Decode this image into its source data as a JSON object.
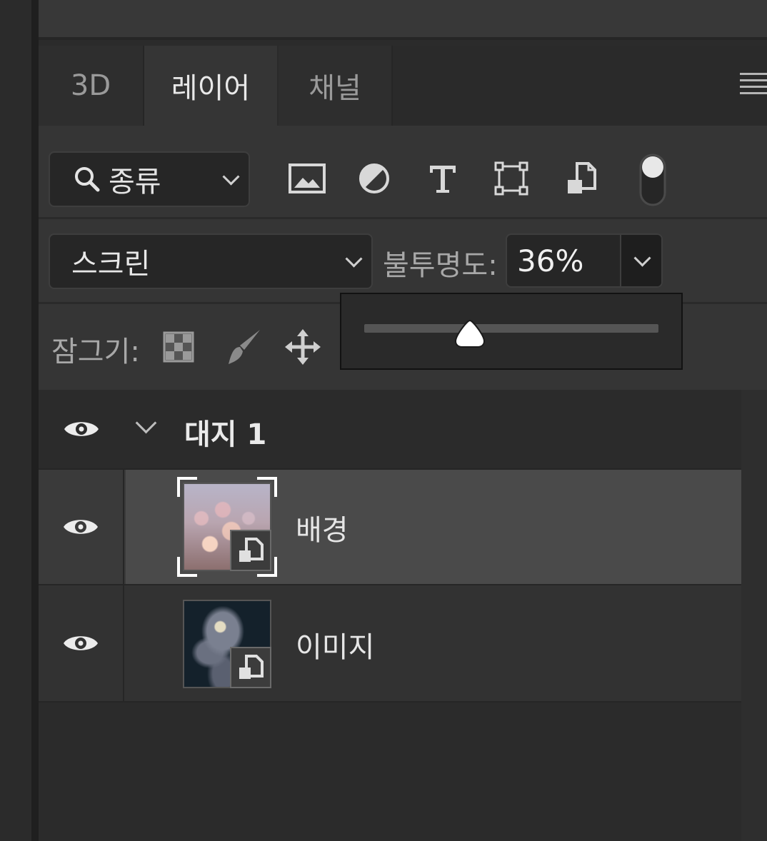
{
  "tabs": [
    {
      "label": "3D"
    },
    {
      "label": "레이어"
    },
    {
      "label": "채널"
    }
  ],
  "filter": {
    "kind_label": "종류",
    "icons": [
      "image-icon",
      "adjustment-icon",
      "type-icon",
      "shape-icon",
      "smart-object-icon",
      "filter-toggle-icon"
    ]
  },
  "blend": {
    "mode": "스크린",
    "opacity_label": "불투명도:",
    "opacity_value": "36%",
    "opacity_level": 0.36
  },
  "lock": {
    "label": "잠그기:",
    "icons": [
      "lock-transparent-pixels-icon",
      "lock-image-pixels-icon",
      "lock-position-icon"
    ]
  },
  "layers": {
    "group": {
      "name": "대지 1"
    },
    "items": [
      {
        "name": "배경",
        "selected": true
      },
      {
        "name": "이미지",
        "selected": false
      }
    ]
  },
  "colors": {
    "panel_bg": "#353535",
    "selected_row": "#4a4a4a",
    "field_bg": "#262626"
  }
}
